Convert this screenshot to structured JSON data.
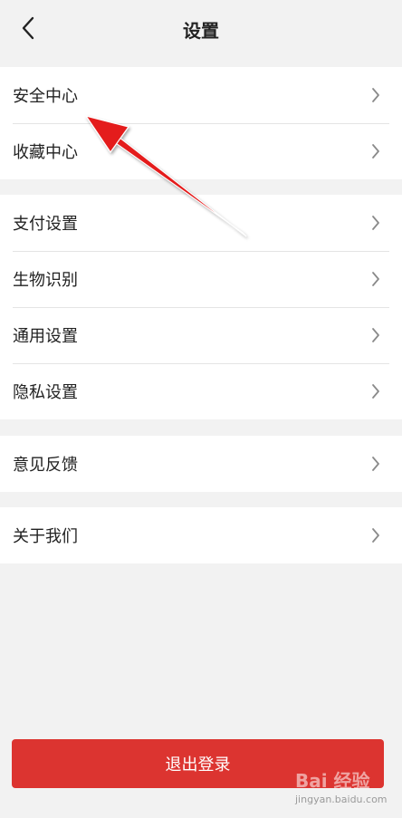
{
  "header": {
    "title": "设置",
    "back_icon": "chevron-left-icon"
  },
  "groups": [
    {
      "items": [
        {
          "label": "安全中心"
        },
        {
          "label": "收藏中心"
        }
      ]
    },
    {
      "items": [
        {
          "label": "支付设置"
        },
        {
          "label": "生物识别"
        },
        {
          "label": "通用设置"
        },
        {
          "label": "隐私设置"
        }
      ]
    },
    {
      "items": [
        {
          "label": "意见反馈"
        }
      ]
    },
    {
      "items": [
        {
          "label": "关于我们"
        }
      ]
    }
  ],
  "logout": {
    "label": "退出登录",
    "color": "#dc3430"
  },
  "annotation": {
    "color": "#e41e1e"
  },
  "watermark": {
    "logo": "Bai 经验",
    "url": "jingyan.baidu.com"
  }
}
